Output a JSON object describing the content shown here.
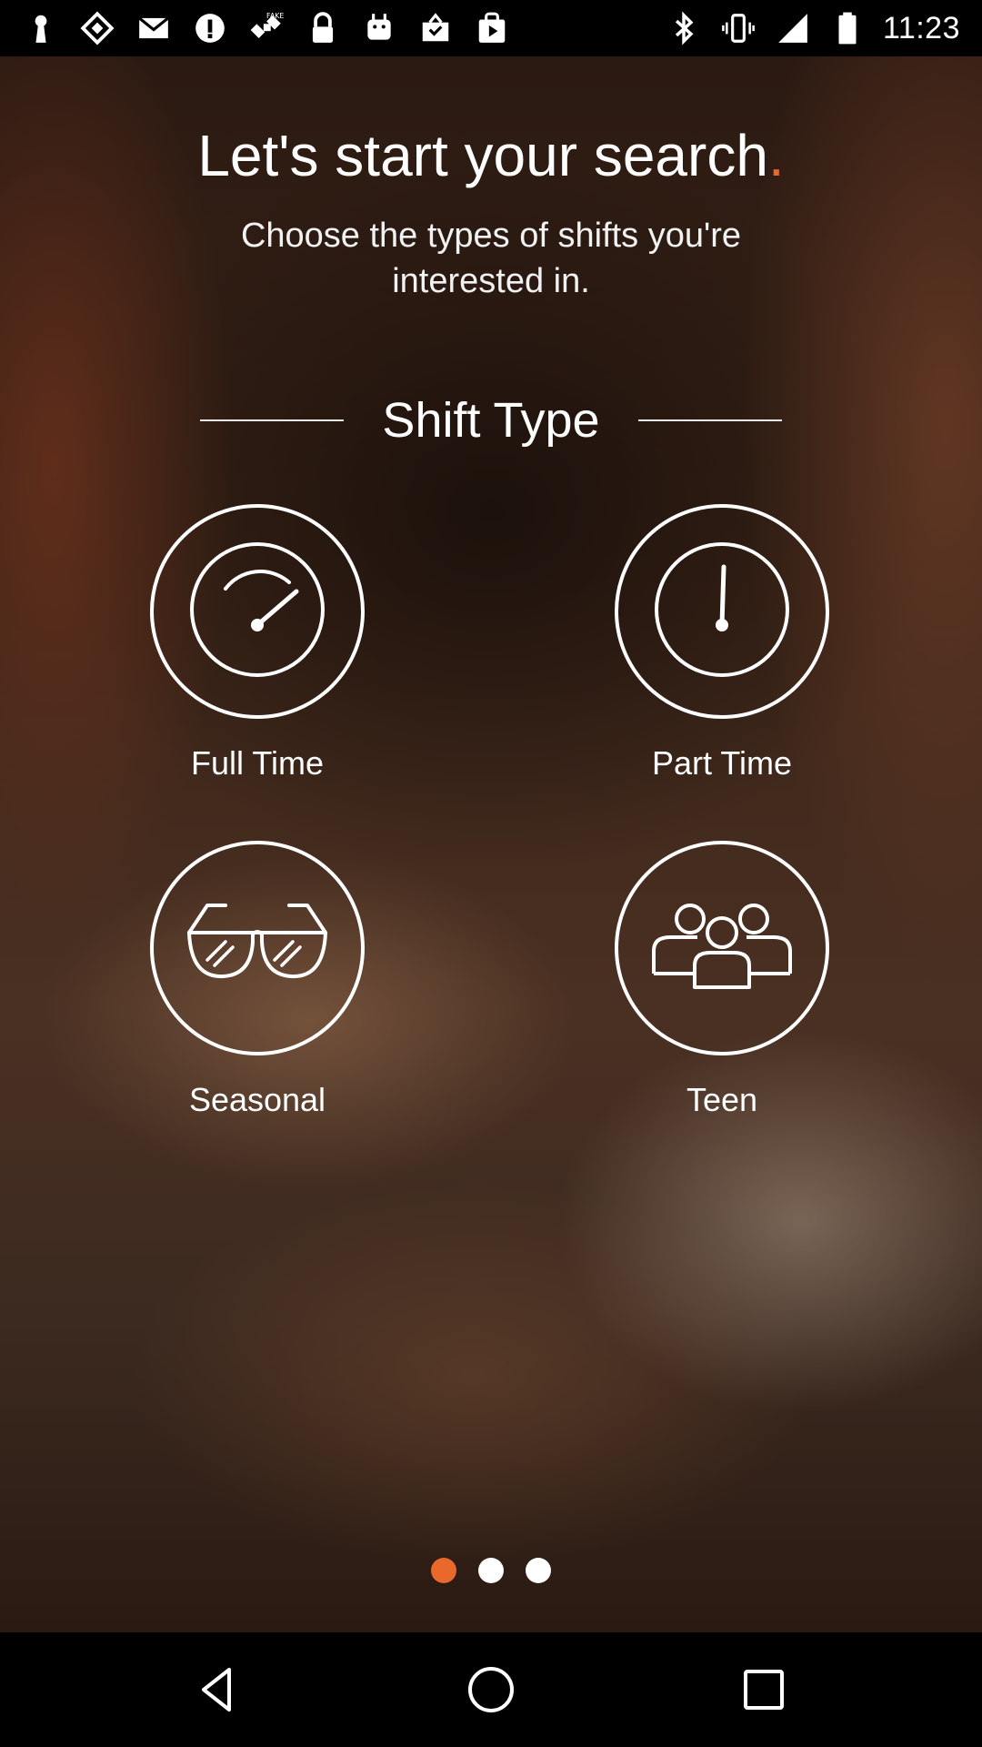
{
  "status_bar": {
    "time": "11:23",
    "left_icons": [
      "keyhole-icon",
      "diamond-icon",
      "gmail-icon",
      "info-icon",
      "satellite-fake-icon",
      "lock-icon",
      "android-icon",
      "inbox-icon",
      "play-store-icon"
    ],
    "right_icons": [
      "bluetooth-icon",
      "vibrate-icon",
      "signal-icon",
      "battery-icon"
    ],
    "fake_gps_text": "FAKE"
  },
  "page": {
    "title_main": "Let's start your search",
    "title_dot": ".",
    "subtitle": "Choose the types of shifts you're interested in.",
    "section_label": "Shift Type",
    "accent_color": "#e8692b"
  },
  "options": [
    {
      "id": "full_time",
      "label": "Full Time",
      "icon": "gauge-icon"
    },
    {
      "id": "part_time",
      "label": "Part Time",
      "icon": "clock-icon"
    },
    {
      "id": "seasonal",
      "label": "Seasonal",
      "icon": "sunglasses-icon"
    },
    {
      "id": "teen",
      "label": "Teen",
      "icon": "group-icon"
    }
  ],
  "pager": {
    "pages": 3,
    "current": 1
  },
  "nav_bar": {
    "buttons": [
      "back-icon",
      "home-icon",
      "recents-icon"
    ]
  }
}
